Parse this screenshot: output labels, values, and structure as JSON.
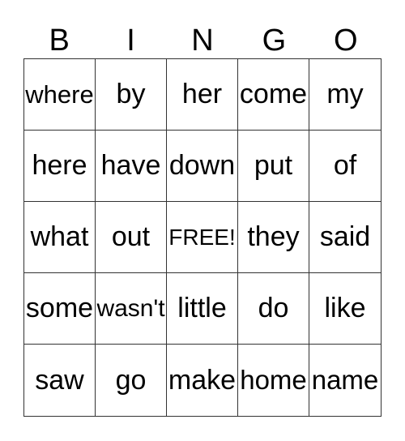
{
  "header": [
    "B",
    "I",
    "N",
    "G",
    "O"
  ],
  "cells": [
    [
      "where",
      "by",
      "her",
      "come",
      "my"
    ],
    [
      "here",
      "have",
      "down",
      "put",
      "of"
    ],
    [
      "what",
      "out",
      "FREE!",
      "they",
      "said"
    ],
    [
      "some",
      "wasn't",
      "little",
      "do",
      "like"
    ],
    [
      "saw",
      "go",
      "make",
      "home",
      "name"
    ]
  ]
}
